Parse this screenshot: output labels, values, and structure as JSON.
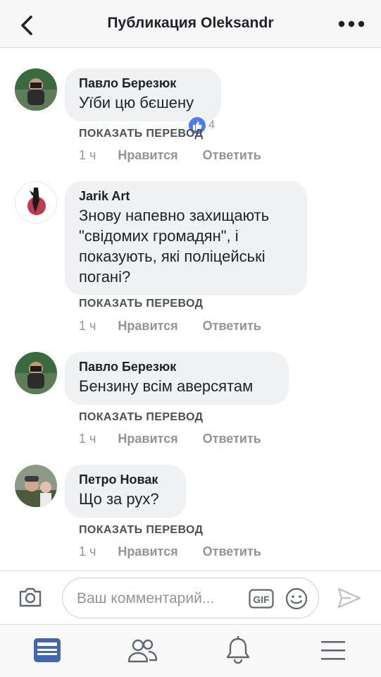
{
  "header": {
    "title": "Публикация Oleksandr"
  },
  "comments": [
    {
      "author": "Павло Березюк",
      "text": [
        "Уїби цю бєшену"
      ],
      "translate": "ПОКАЗАТЬ ПЕРЕВОД",
      "time": "1 ч",
      "like": "Нравится",
      "reply": "Ответить",
      "reactions": "4"
    },
    {
      "author": "Jarik Art",
      "text": [
        "Знову напевно захищають",
        "\"свідомих громадян\", і",
        "показують, які поліцейські",
        "погані?"
      ],
      "translate": "ПОКАЗАТЬ ПЕРЕВОД",
      "time": "1 ч",
      "like": "Нравится",
      "reply": "Ответить"
    },
    {
      "author": "Павло Березюк",
      "text": [
        "Бензину всім аверсятам"
      ],
      "translate": "ПОКАЗАТЬ ПЕРЕВОД",
      "time": "1 ч",
      "like": "Нравится",
      "reply": "Ответить"
    },
    {
      "author": "Петро Новак",
      "text": [
        "Що за рух?"
      ],
      "translate": "ПОКАЗАТЬ ПЕРЕВОД",
      "time": "1 ч",
      "like": "Нравится",
      "reply": "Ответить"
    }
  ],
  "composer": {
    "placeholder": "Ваш комментарий...",
    "gif_label": "GIF"
  },
  "icons": {
    "back": "chevron-left-icon",
    "more": "more-dots-icon",
    "camera": "camera-icon",
    "gif": "gif-icon",
    "emoji": "emoji-icon",
    "send": "send-icon",
    "tab_feed": "news-feed-icon",
    "tab_friends": "friends-icon",
    "tab_notifications": "bell-icon",
    "tab_menu": "menu-icon"
  },
  "colors": {
    "accent": "#4267b2",
    "bubble": "#f0f1f3",
    "meta_text": "#90949c",
    "like_badge": "#4f7cf5"
  }
}
